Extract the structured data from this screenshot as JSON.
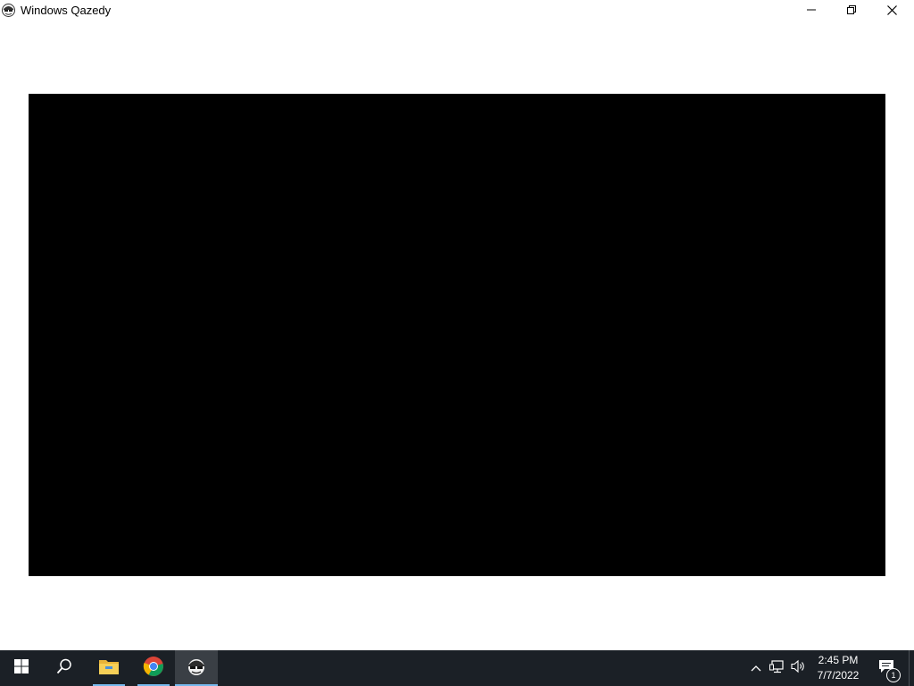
{
  "window": {
    "title": "Windows Qazedy",
    "buttons": {
      "minimize": "minimize-icon",
      "restore": "restore-icon",
      "close": "close-icon"
    },
    "viewport_color": "#000000"
  },
  "taskbar": {
    "items": [
      {
        "name": "start",
        "icon": "windows-logo-icon"
      },
      {
        "name": "search",
        "icon": "search-icon"
      },
      {
        "name": "file-explorer",
        "icon": "folder-icon"
      },
      {
        "name": "chrome",
        "icon": "chrome-icon"
      },
      {
        "name": "qazedy",
        "icon": "qazedy-app-icon",
        "active": true
      }
    ],
    "tray": {
      "time": "2:45 PM",
      "date": "7/7/2022",
      "notification_count": "1"
    },
    "colors": {
      "background": "#1b2026",
      "accent_underline": "#76b9ed"
    }
  }
}
